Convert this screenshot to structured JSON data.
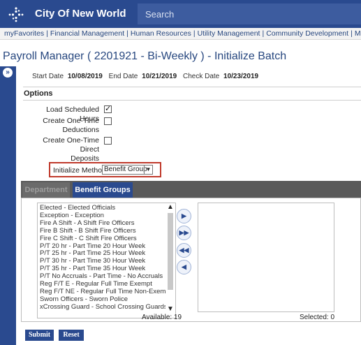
{
  "header": {
    "app_title": "City Of New World",
    "search_placeholder": "Search",
    "logo_icon": "dotted-star-logo",
    "colors": {
      "nav": "#2a4a8f",
      "accent_red": "#c0392b"
    }
  },
  "menu": {
    "items": [
      "myFavorites",
      "Financial Management",
      "Human Resources",
      "Utility Management",
      "Community Development",
      "Mainter"
    ]
  },
  "page": {
    "title": "Payroll Manager ( 2201921 - Bi-Weekly ) - Initialize Batch",
    "start_date_label": "Start Date",
    "start_date": "10/08/2019",
    "end_date_label": "End Date",
    "end_date": "10/21/2019",
    "check_date_label": "Check Date",
    "check_date": "10/23/2019"
  },
  "options": {
    "heading": "Options",
    "load_hours": {
      "label": "Load Scheduled Hours",
      "checked": true
    },
    "one_time_deductions": {
      "label_line1": "Create One-Time",
      "label_line2": "Deductions",
      "checked": false
    },
    "one_time_deposits": {
      "label_line1": "Create One-Time Direct",
      "label_line2": "Deposits",
      "checked": false
    },
    "init_method_label": "Initialize Method",
    "init_method_value": "Benefit Group"
  },
  "tabs": [
    "Department",
    "Benefit Groups"
  ],
  "available": {
    "items": [
      "Elected - Elected Officials",
      "Exception - Exception",
      "Fire A Shift - A Shift Fire Officers",
      "Fire B Shift - B Shift Fire Officers",
      "Fire C Shift - C Shift Fire Officers",
      "P/T 20 hr - Part Time 20 Hour Week",
      "P/T 25 hr - Part Time 25 Hour Week",
      "P/T 30 hr - Part Time 30 Hour Week",
      "P/T 35 hr - Part Time 35 Hour Week",
      "P/T No Accruals - Part Time - No Accruals",
      "Reg F/T E - Regular Full Time Exempt",
      "Reg F/T NE - Regular Full Time Non-Exempt",
      "Sworn Officers - Sworn Police",
      "xCrossing Guard - School Crossing Guards"
    ],
    "count_label": "Available: 19"
  },
  "selected": {
    "count_label": "Selected: 0"
  },
  "actions": {
    "submit": "Submit",
    "reset": "Reset"
  }
}
